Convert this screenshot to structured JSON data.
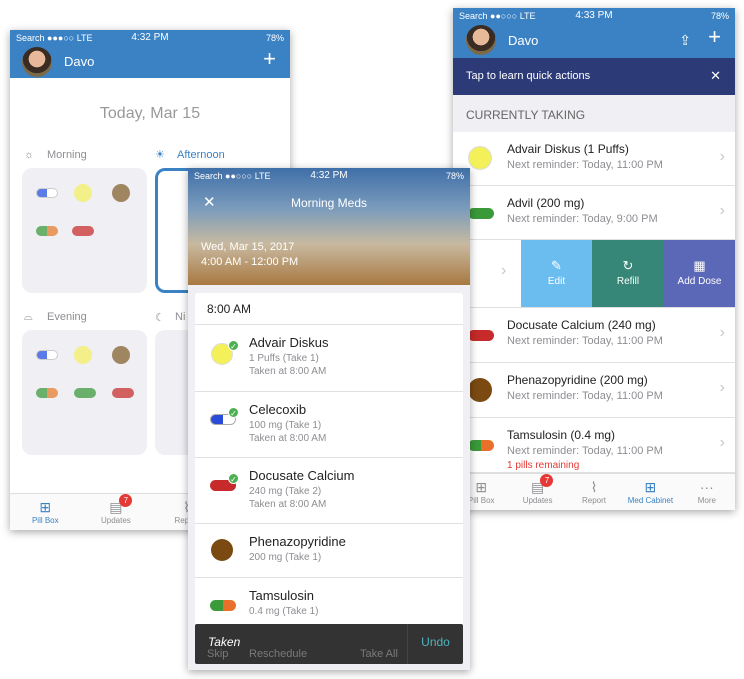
{
  "status_left": {
    "back": "Search",
    "carrier": "LTE",
    "time": "4:32 PM",
    "battery": "78%"
  },
  "status_mid": {
    "back": "Search",
    "carrier": "LTE",
    "time": "4:32 PM",
    "battery": "78%"
  },
  "status_right": {
    "back": "Search",
    "carrier": "LTE",
    "time": "4:33 PM",
    "battery": "78%"
  },
  "colors": {
    "header": "#3b82c4",
    "banner": "#2c3a78",
    "edit": "#6bbdf0",
    "refill": "#378778",
    "add_dose": "#5b68b8",
    "badge": "#e53935",
    "warning": "#e53935"
  },
  "pillbox": {
    "user": "Davo",
    "add_icon": "plus-icon",
    "date": "Today, Mar 15",
    "sections": {
      "morning": "Morning",
      "afternoon": "Afternoon",
      "evening": "Evening",
      "night": "Ni"
    }
  },
  "tabs": {
    "pillbox": "Pill Box",
    "updates": "Updates",
    "updates_badge": "7",
    "report": "Report",
    "med_cabinet": "Med Cabinet",
    "more": "More",
    "m": "M"
  },
  "morning_meds": {
    "title": "Morning Meds",
    "date": "Wed, Mar 15, 2017",
    "range": "4:00 AM - 12:00 PM",
    "time_header": "8:00 AM",
    "items": [
      {
        "name": "Advair Diskus",
        "dose": "1 Puffs (Take 1)",
        "taken": "Taken at 8:00 AM"
      },
      {
        "name": "Celecoxib",
        "dose": "100 mg (Take 1)",
        "taken": "Taken at 8:00 AM"
      },
      {
        "name": "Docusate Calcium",
        "dose": "240 mg (Take 2)",
        "taken": "Taken at 8:00 AM"
      },
      {
        "name": "Phenazopyridine",
        "dose": "200 mg (Take 1)"
      },
      {
        "name": "Tamsulosin",
        "dose": "0.4 mg (Take 1)"
      }
    ],
    "footer": {
      "skip": "Skip",
      "reschedule": "Reschedule",
      "take_all": "Take All"
    },
    "toast": {
      "text": "Taken",
      "undo": "Undo"
    }
  },
  "cabinet": {
    "user": "Davo",
    "banner": "Tap to learn quick actions",
    "section": "CURRENTLY TAKING",
    "items": [
      {
        "name": "Advair Diskus (1 Puffs)",
        "reminder": "Next reminder: Today, 11:00 PM"
      },
      {
        "name": "Advil (200 mg)",
        "reminder": "Next reminder: Today, 9:00 PM"
      },
      {
        "name": "Docusate Calcium (240 mg)",
        "reminder": "Next reminder: Today, 11:00 PM"
      },
      {
        "name": "Phenazopyridine (200 mg)",
        "reminder": "Next reminder: Today, 11:00 PM"
      },
      {
        "name": "Tamsulosin (0.4 mg)",
        "reminder": "Next reminder: Today, 11:00 PM",
        "warning": "1 pills remaining"
      }
    ],
    "actions": {
      "edit": "Edit",
      "refill": "Refill",
      "add_dose": "Add Dose"
    }
  }
}
